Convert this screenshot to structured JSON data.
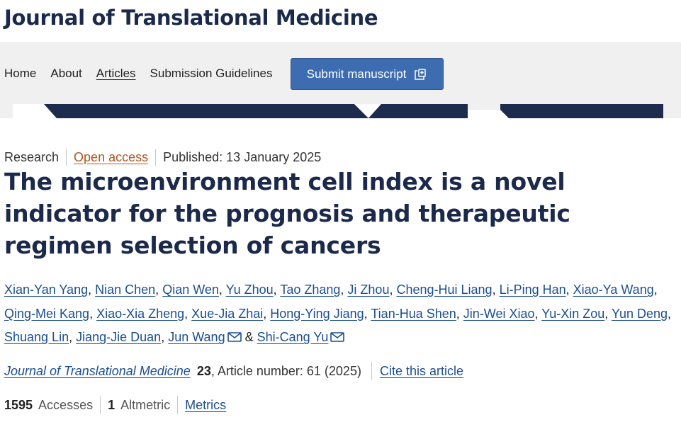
{
  "journal": {
    "title": "Journal of Translational Medicine"
  },
  "nav": {
    "home": "Home",
    "about": "About",
    "articles": "Articles",
    "guidelines": "Submission Guidelines",
    "submit": "Submit manuscript"
  },
  "article": {
    "type": "Research",
    "access": "Open access",
    "published": "Published: 13 January 2025",
    "title": "The microenvironment cell index is a novel indicator for the prognosis and therapeutic regimen selection of cancers",
    "authors": [
      "Xian-Yan Yang",
      "Nian Chen",
      "Qian Wen",
      "Yu Zhou",
      "Tao Zhang",
      "Ji Zhou",
      "Cheng-Hui Liang",
      "Li-Ping Han",
      "Xiao-Ya Wang",
      "Qing-Mei Kang",
      "Xiao-Xia Zheng",
      "Xue-Jia Zhai",
      "Hong-Ying Jiang",
      "Tian-Hua Shen",
      "Jin-Wei Xiao",
      "Yu-Xin Zou",
      "Yun Deng",
      "Shuang Lin",
      "Jiang-Jie Duan",
      "Jun Wang",
      "Shi-Cang Yu"
    ],
    "authors_and": "&",
    "citation": {
      "journal": "Journal of Translational Medicine",
      "volume": "23",
      "article_number": ", Article number: 61 (2025)",
      "cite": "Cite this article"
    },
    "metrics": {
      "accesses_count": "1595",
      "accesses_label": "Accesses",
      "altmetric_count": "1",
      "altmetric_label": "Altmetric",
      "metrics_link": "Metrics"
    }
  },
  "icons": {
    "submit": "external-link-icon",
    "mail": "mail-icon"
  },
  "colors": {
    "brand": "#1b2a4a",
    "button": "#3e6cb0",
    "link": "#1c4e8f",
    "open_access": "#b05521"
  }
}
